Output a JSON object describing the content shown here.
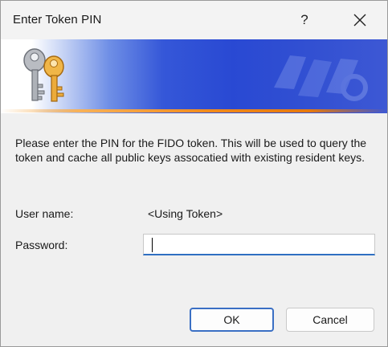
{
  "window": {
    "title": "Enter Token PIN"
  },
  "titlebar": {
    "help_label": "?",
    "help_icon": "question-mark",
    "close_icon": "close-x"
  },
  "banner": {
    "icon": "keys-icon"
  },
  "message": "Please enter the PIN for the FIDO token. This will be used to query the token and cache all public keys assocatied with existing resident keys.",
  "form": {
    "username_label": "User name:",
    "username_value": "<Using Token>",
    "password_label": "Password:",
    "password_value": ""
  },
  "buttons": {
    "ok": "OK",
    "cancel": "Cancel"
  },
  "colors": {
    "banner_blue": "#2949d3",
    "banner_accent": "#f08a1c",
    "focus_blue": "#2f6fc2"
  }
}
